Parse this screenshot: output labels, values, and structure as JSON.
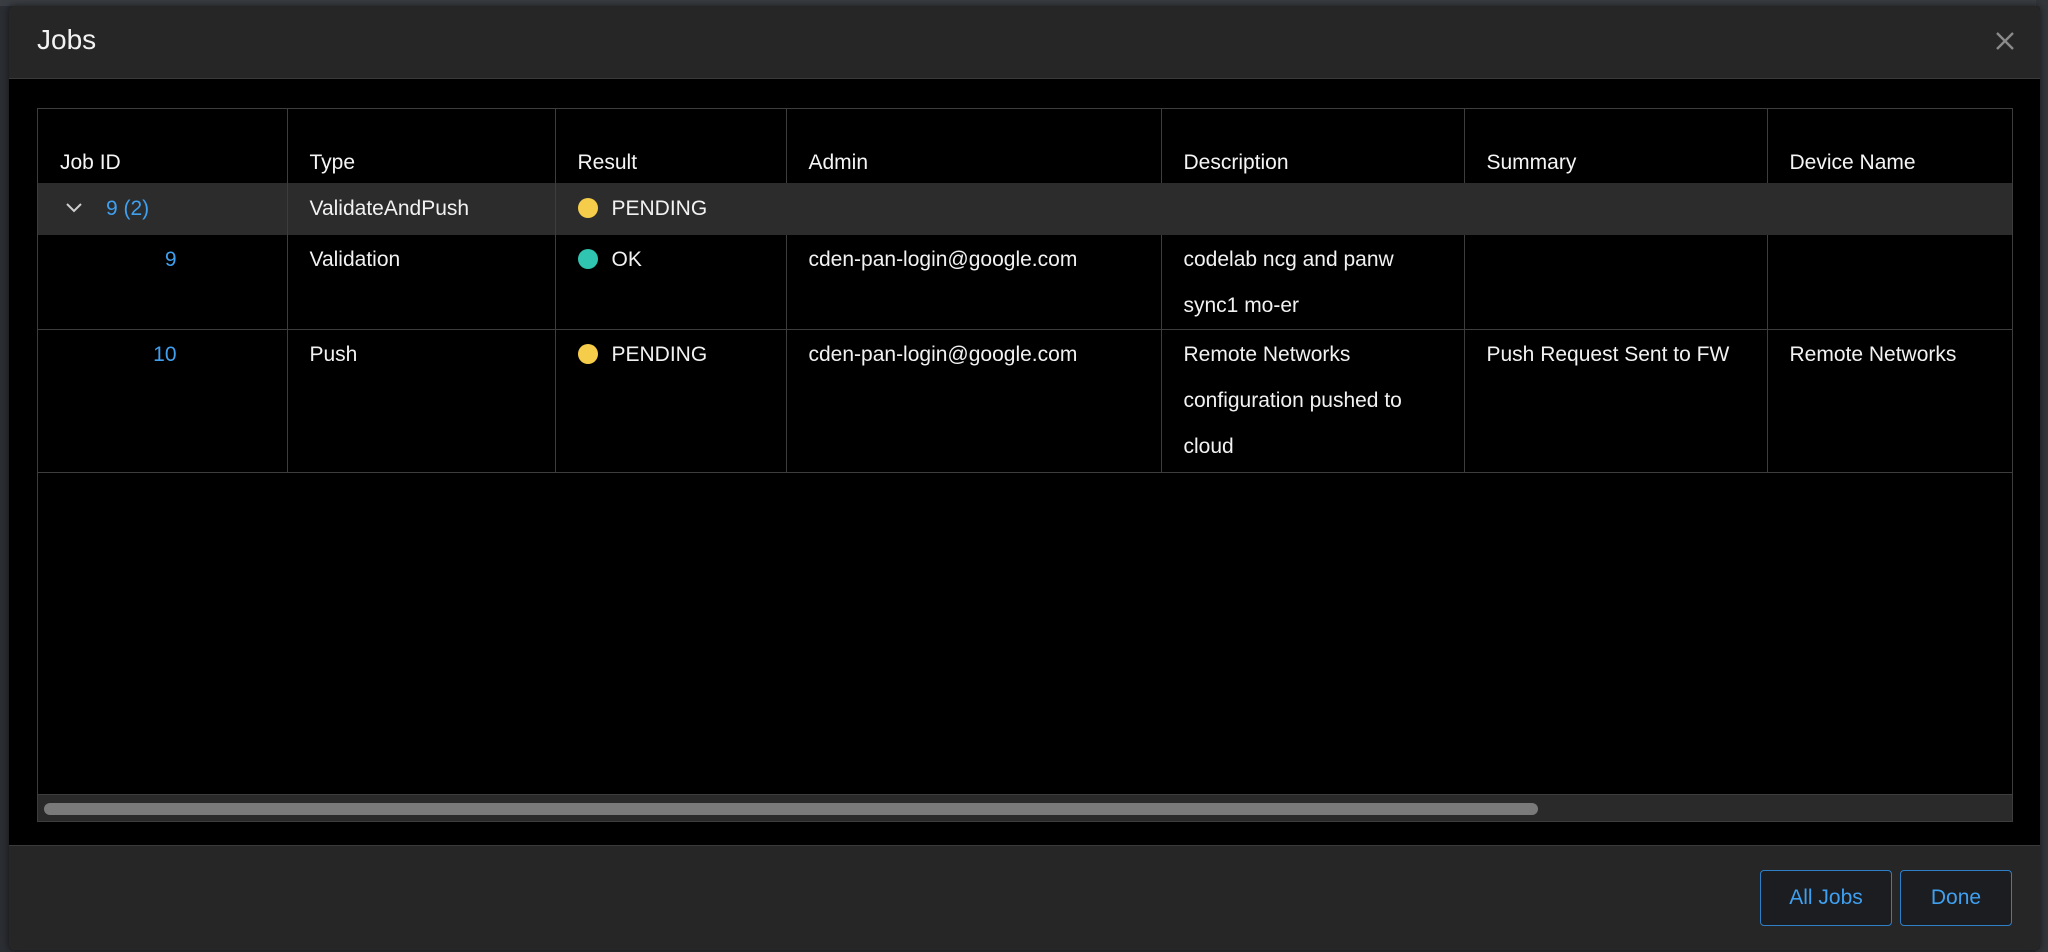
{
  "modal": {
    "title": "Jobs"
  },
  "table": {
    "columns": [
      "Job ID",
      "Type",
      "Result",
      "Admin",
      "Description",
      "Summary",
      "Device Name"
    ],
    "group": {
      "job_id": "9 (2)",
      "type": "ValidateAndPush",
      "result": "PENDING",
      "result_color": "#f6cd4b"
    },
    "rows": [
      {
        "job_id": "9",
        "type": "Validation",
        "result": "OK",
        "result_color": "#2fc5b0",
        "admin": "cden-pan-login@google.com",
        "description": "codelab ncg and panw sync1 mo-er",
        "summary": "",
        "device_name": ""
      },
      {
        "job_id": "10",
        "type": "Push",
        "result": "PENDING",
        "result_color": "#f6cd4b",
        "admin": "cden-pan-login@google.com",
        "description": "Remote Networks configuration pushed to cloud",
        "summary": "Push Request Sent to FW",
        "device_name": "Remote Networks"
      }
    ]
  },
  "footer": {
    "all_jobs_label": "All Jobs",
    "done_label": "Done"
  },
  "colors": {
    "accent": "#3fa0f0",
    "pending": "#f6cd4b",
    "ok": "#2fc5b0"
  }
}
